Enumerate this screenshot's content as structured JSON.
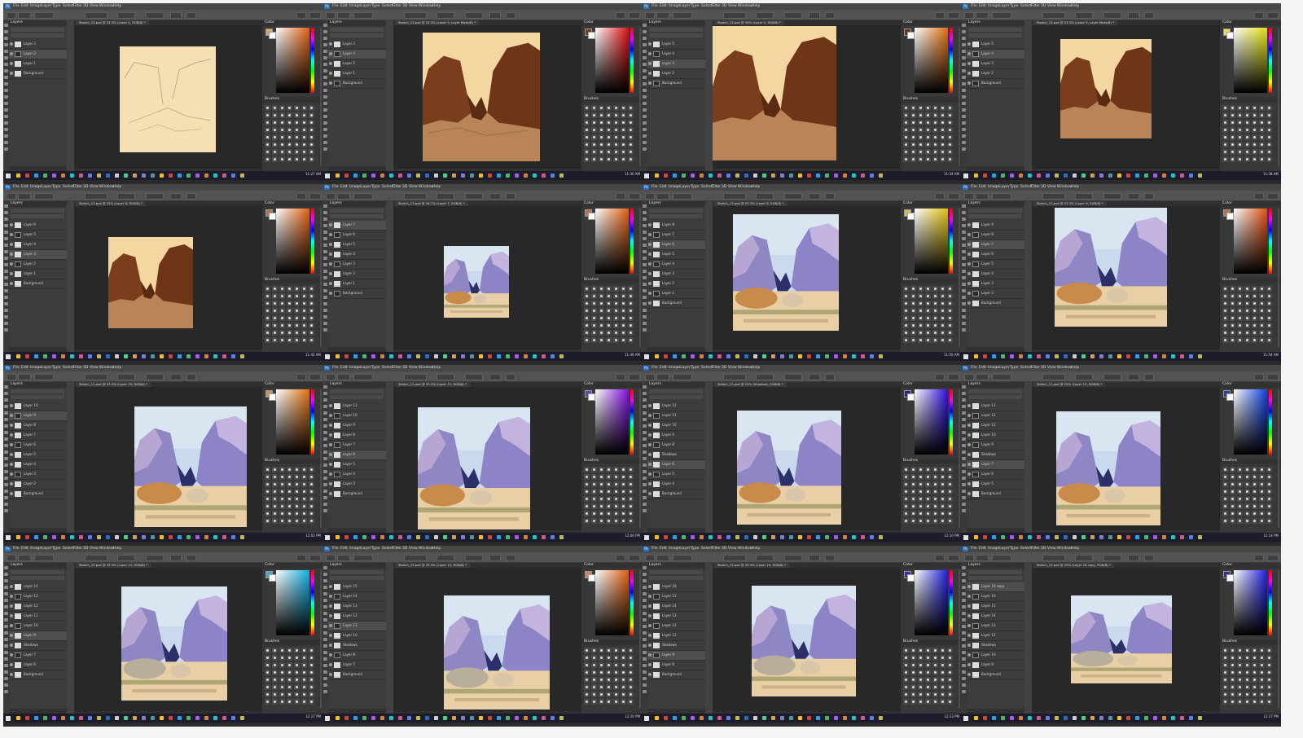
{
  "app": {
    "logo": "Ps",
    "menus": [
      "File",
      "Edit",
      "Image",
      "Layer",
      "Type",
      "Select",
      "Filter",
      "3D",
      "View",
      "Window",
      "Help"
    ]
  },
  "panels": {
    "layers_title": "Layers",
    "color_title": "Color",
    "brushes_title": "Brushes"
  },
  "tiles": [
    {
      "doc_tab": "Sketch_13.psd @ 33.3% (Layer 2, RGB/8) *",
      "stage": "sketch",
      "fg_color": "#d9a95b",
      "picker_hue": "#e06010",
      "layers": [
        "Layer 3",
        "Layer 2",
        "Layer 1",
        "Background"
      ],
      "selected": 1,
      "clock": "11:27 AM"
    },
    {
      "doc_tab": "Sketch_13.psd @ 33.3% (Layer 3, Layer Mask/8) *",
      "stage": "blockin-sketch",
      "fg_color": "#7a3c1c",
      "picker_hue": "#e01010",
      "layers": [
        "Layer 3",
        "Layer 4",
        "Layer 2",
        "Layer 1",
        "Background"
      ],
      "selected": 1,
      "clock": "11:30 AM"
    },
    {
      "doc_tab": "Sketch_13.psd @ 50% (Layer 5, RGB/8) *",
      "stage": "blockin-big",
      "fg_color": "#6b3418",
      "picker_hue": "#e07010",
      "layers": [
        "Layer 5",
        "Layer 4",
        "Layer 3",
        "Layer 2",
        "Background"
      ],
      "selected": 2,
      "clock": "11:34 AM"
    },
    {
      "doc_tab": "Sketch_13.psd @ 33.3% (Layer 5, Layer Mask/8) *",
      "stage": "blockin",
      "fg_color": "#f0e040",
      "picker_hue": "#e0e010",
      "layers": [
        "Layer 5",
        "Layer 4",
        "Layer 3",
        "Layer 2",
        "Background"
      ],
      "selected": 1,
      "clock": "11:38 AM"
    },
    {
      "doc_tab": "Sketch_13.psd @ 25% (Layer 6, RGB/8) *",
      "stage": "blockin-small",
      "fg_color": "#c07040",
      "picker_hue": "#e06010",
      "layers": [
        "Layer 6",
        "Layer 5",
        "Layer 4",
        "Layer 3",
        "Layer 2",
        "Layer 1",
        "Background"
      ],
      "selected": 3,
      "clock": "11:42 AM"
    },
    {
      "doc_tab": "Sketch_13.psd @ 16.7% (Layer 7, RGB/8) *",
      "stage": "color-tiny",
      "fg_color": "#c87040",
      "picker_hue": "#e06010",
      "layers": [
        "Layer 7",
        "Layer 6",
        "Layer 5",
        "Layer 4",
        "Layer 3",
        "Layer 2",
        "Layer 1",
        "Background"
      ],
      "selected": 0,
      "clock": "11:46 AM"
    },
    {
      "doc_tab": "Sketch_13.psd @ 33.3% (Layer 8, RGB/8) *",
      "stage": "color-1",
      "fg_color": "#d8c040",
      "picker_hue": "#e0c010",
      "layers": [
        "Layer 8",
        "Layer 7",
        "Layer 6",
        "Layer 5",
        "Layer 4",
        "Layer 3",
        "Layer 2",
        "Layer 1",
        "Background"
      ],
      "selected": 2,
      "clock": "11:50 AM"
    },
    {
      "doc_tab": "Sketch_13.psd @ 33.3% (Layer 9, RGB/8) *",
      "stage": "color-2",
      "fg_color": "#c87040",
      "picker_hue": "#e05010",
      "layers": [
        "Layer 9",
        "Layer 8",
        "Layer 7",
        "Layer 6",
        "Layer 5",
        "Layer 4",
        "Layer 3",
        "Layer 2",
        "Background"
      ],
      "selected": 2,
      "clock": "11:54 AM"
    },
    {
      "doc_tab": "Sketch_13.psd @ 33.3% (Layer 10, RGB/8) *",
      "stage": "color-3",
      "fg_color": "#d89050",
      "picker_hue": "#e07010",
      "layers": [
        "Layer 10",
        "Layer 9",
        "Layer 8",
        "Layer 7",
        "Layer 6",
        "Layer 5",
        "Layer 4",
        "Layer 3",
        "Layer 2",
        "Background"
      ],
      "selected": 1,
      "clock": "12:02 PM"
    },
    {
      "doc_tab": "Sketch_13.psd @ 33.3% (Layer 11, RGB/8) *",
      "stage": "color-4",
      "fg_color": "#6040c0",
      "picker_hue": "#8010e0",
      "layers": [
        "Layer 11",
        "Layer 10",
        "Layer 9",
        "Layer 8",
        "Layer 7",
        "Layer 6",
        "Layer 5",
        "Layer 4",
        "Layer 3",
        "Background"
      ],
      "selected": 5,
      "clock": "12:06 PM"
    },
    {
      "doc_tab": "Sketch_13.psd @ 25% (Shadows, RGB/8) *",
      "stage": "color-5",
      "fg_color": "#3020a0",
      "picker_hue": "#3010e0",
      "layers": [
        "Layer 12",
        "Layer 11",
        "Layer 10",
        "Layer 9",
        "Layer 8",
        "Shadows",
        "Layer 6",
        "Layer 5",
        "Layer 4",
        "Background"
      ],
      "selected": 6,
      "clock": "12:10 PM"
    },
    {
      "doc_tab": "Sketch_13.psd @ 25% (Layer 13, RGB/8) *",
      "stage": "color-6",
      "fg_color": "#2040b0",
      "picker_hue": "#1040e0",
      "layers": [
        "Layer 13",
        "Layer 12",
        "Layer 11",
        "Layer 10",
        "Layer 9",
        "Shadows",
        "Layer 7",
        "Layer 6",
        "Layer 5",
        "Background"
      ],
      "selected": 6,
      "clock": "12:14 PM"
    },
    {
      "doc_tab": "Sketch_13.psd @ 33.3% (Layer 14, RGB/8) *",
      "stage": "final-1",
      "fg_color": "#40a8d8",
      "picker_hue": "#10b0e0",
      "layers": [
        "Layer 14",
        "Layer 13",
        "Layer 12",
        "Layer 11",
        "Layer 10",
        "Layer 9",
        "Shadows",
        "Layer 7",
        "Layer 6",
        "Background"
      ],
      "selected": 5,
      "clock": "12:17 PM"
    },
    {
      "doc_tab": "Sketch_13.psd @ 33.3% (Layer 15, RGB/8) *",
      "stage": "final-2",
      "fg_color": "#d88050",
      "picker_hue": "#e06010",
      "layers": [
        "Layer 15",
        "Layer 14",
        "Layer 13",
        "Layer 12",
        "Layer 11",
        "Layer 10",
        "Shadows",
        "Layer 8",
        "Layer 7",
        "Background"
      ],
      "selected": 4,
      "clock": "12:20 PM"
    },
    {
      "doc_tab": "Sketch_13.psd @ 33.3% (Layer 16, RGB/8) *",
      "stage": "final-3",
      "fg_color": "#3030b0",
      "picker_hue": "#2020e0",
      "layers": [
        "Layer 16",
        "Layer 15",
        "Layer 14",
        "Layer 13",
        "Layer 12",
        "Layer 11",
        "Shadows",
        "Layer 9",
        "Layer 8",
        "Background"
      ],
      "selected": 7,
      "clock": "12:23 PM"
    },
    {
      "doc_tab": "Sketch_13.psd @ 25% (Layer 16 copy, RGB/8) *",
      "stage": "final-transform",
      "fg_color": "#2a30a8",
      "picker_hue": "#2020e0",
      "layers": [
        "Layer 16 copy",
        "Layer 16",
        "Layer 15",
        "Layer 14",
        "Layer 13",
        "Layer 12",
        "Shadows",
        "Layer 10",
        "Layer 9",
        "Background"
      ],
      "selected": 0,
      "clock": "12:27 PM"
    }
  ]
}
